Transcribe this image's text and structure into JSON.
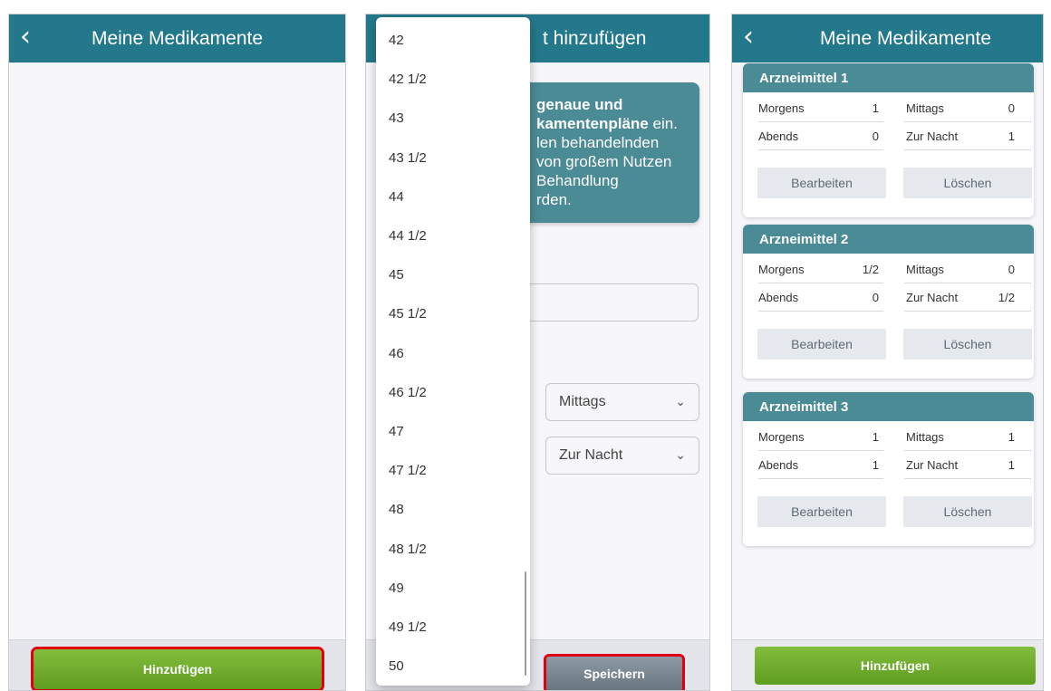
{
  "screen1": {
    "title": "Meine Medikamente",
    "back_glyph": "‹",
    "add_button": "Hinzufügen"
  },
  "screen2": {
    "title_partial": "t hinzufügen",
    "info_line1": "genaue und",
    "info_line2_bold": "kamentenpläne",
    "info_line2_rest": " ein.",
    "info_line3": "len behandelnden",
    "info_line4": "von großem Nutzen",
    "info_line5": "Behandlung",
    "info_line6": "rden.",
    "select_mittags": "Mittags",
    "select_zur_nacht": "Zur Nacht",
    "chevron": "⌄",
    "save_button": "Speichern",
    "dropdown_options": [
      "42",
      "42 1/2",
      "43",
      "43 1/2",
      "44",
      "44 1/2",
      "45",
      "45 1/2",
      "46",
      "46 1/2",
      "47",
      "47 1/2",
      "48",
      "48 1/2",
      "49",
      "49 1/2",
      "50"
    ]
  },
  "screen3": {
    "title": "Meine Medikamente",
    "back_glyph": "‹",
    "edit_label": "Bearbeiten",
    "delete_label": "Löschen",
    "add_button": "Hinzufügen",
    "labels": {
      "morgens": "Morgens",
      "mittags": "Mittags",
      "abends": "Abends",
      "nacht": "Zur Nacht"
    },
    "cards": [
      {
        "name": "Arzneimittel 1",
        "morgens": "1",
        "mittags": "0",
        "abends": "0",
        "nacht": "1"
      },
      {
        "name": "Arzneimittel 2",
        "morgens": "1/2",
        "mittags": "0",
        "abends": "0",
        "nacht": "1/2"
      },
      {
        "name": "Arzneimittel 3",
        "morgens": "1",
        "mittags": "1",
        "abends": "1",
        "nacht": "1"
      }
    ]
  },
  "colors": {
    "header": "#23798b",
    "card_header": "#4a8b95",
    "add_button": "#6fae2c",
    "highlight": "#e1000f"
  }
}
